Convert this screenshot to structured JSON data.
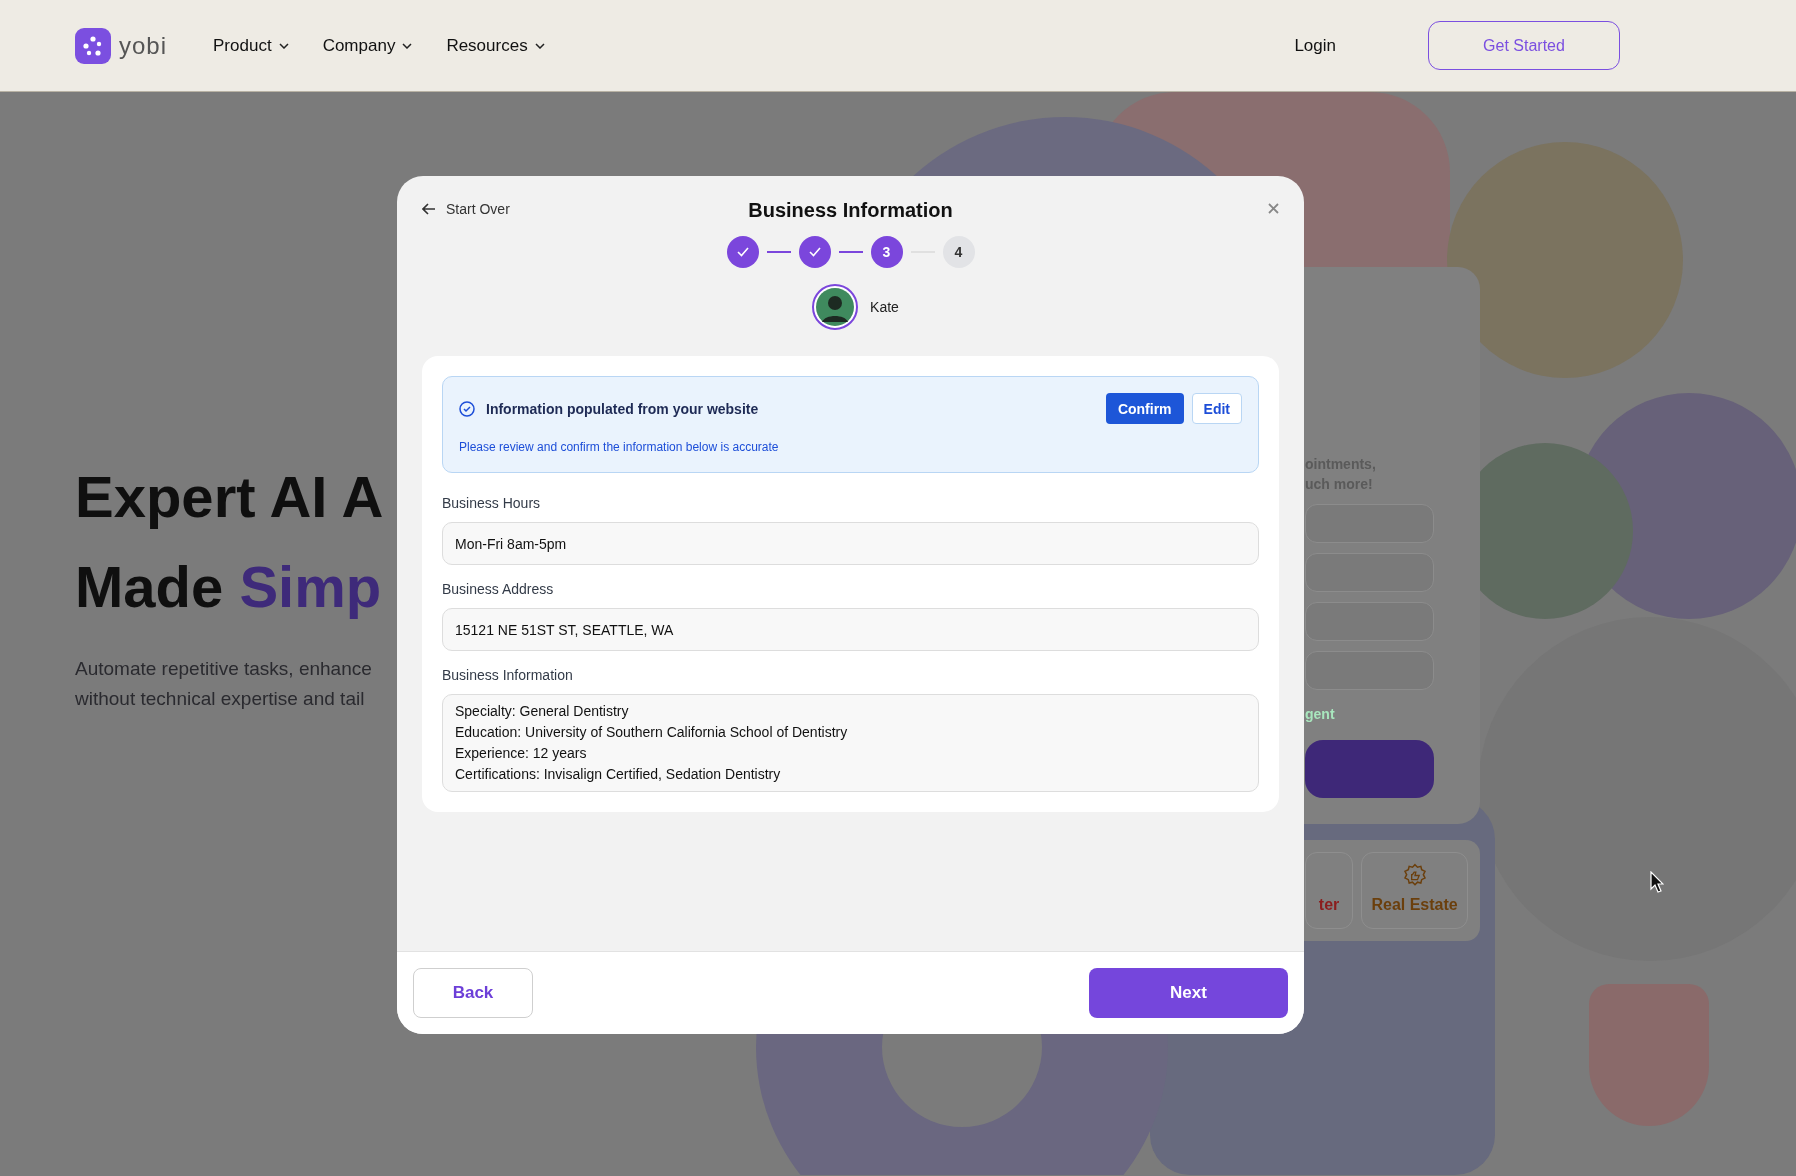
{
  "nav": {
    "logo_text": "yobi",
    "menu": [
      {
        "label": "Product"
      },
      {
        "label": "Company"
      },
      {
        "label": "Resources"
      }
    ],
    "login": "Login",
    "cta": "Get Started"
  },
  "hero": {
    "title_line_1": "Expert AI A",
    "title_line_2": "Made",
    "title_accent": "Simp",
    "subtitle_lines": [
      "Automate repetitive tasks, enhance",
      "without technical expertise and tail"
    ]
  },
  "signup_card": {
    "text_lines": [
      "ointments,",
      "uch more!"
    ],
    "link": "gent",
    "industry_tiles": [
      {
        "label": "ter",
        "color": "#8b1e1e"
      },
      {
        "label": "Real Estate",
        "color": "#6b3f0c"
      }
    ]
  },
  "modal": {
    "back_link": "Start Over",
    "title": "Business Information",
    "steps": [
      {
        "kind": "done"
      },
      {
        "kind": "done"
      },
      {
        "kind": "current",
        "label": "3"
      },
      {
        "kind": "upcoming",
        "label": "4"
      }
    ],
    "agent": {
      "name": "Kate"
    },
    "notice": {
      "title": "Information populated from your website",
      "text": "Please review and confirm the information below is accurate",
      "actions": [
        {
          "label": "Confirm",
          "kind": "primary"
        },
        {
          "label": "Edit",
          "kind": "secondary"
        }
      ]
    },
    "fields": [
      {
        "kind": "input",
        "label": "Business Hours",
        "value": "Mon-Fri 8am-5pm"
      },
      {
        "kind": "input",
        "label": "Business Address",
        "value": "15121 NE 51ST ST, SEATTLE, WA"
      },
      {
        "kind": "textarea",
        "label": "Business Information",
        "lines": [
          "Specialty: General Dentistry",
          "Education: University of Southern California School of Dentistry",
          "Experience: 12 years",
          "Certifications: Invisalign Certified, Sedation Dentistry"
        ]
      }
    ],
    "footer": {
      "back": "Back",
      "next": "Next"
    }
  }
}
